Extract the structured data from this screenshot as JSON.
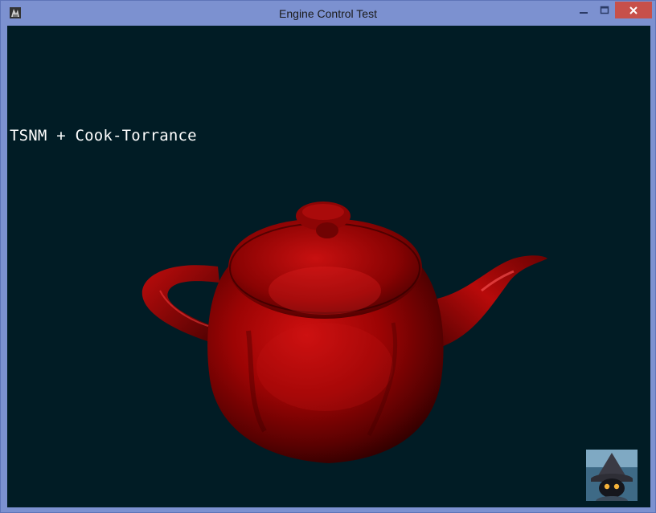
{
  "window": {
    "title": "Engine Control Test",
    "icon": "app-icon",
    "controls": [
      "minimize-icon",
      "maximize-icon",
      "close-icon"
    ],
    "colors": {
      "frame": "#7C91D0",
      "close": "#C7504A",
      "viewport": "#011C25"
    }
  },
  "viewport": {
    "overlay_text": "TSNM + Cook-Torrance",
    "object": "red-teapot",
    "corner_image": "hooded-mage-portrait"
  }
}
